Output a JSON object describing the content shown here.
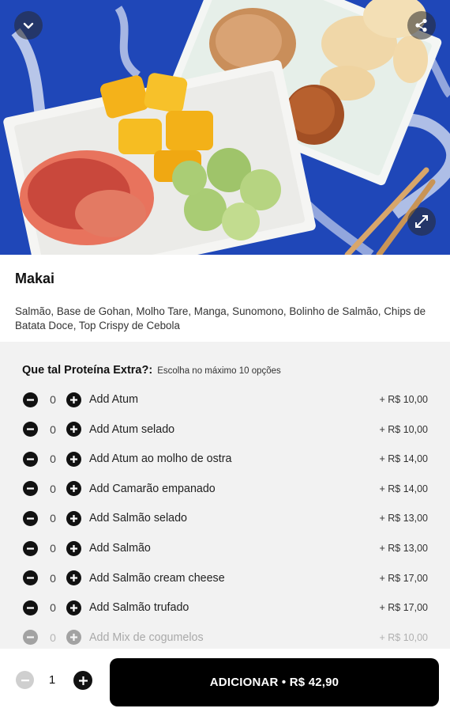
{
  "hero": {
    "collapse_icon": "chevron-down-icon",
    "share_icon": "share-icon",
    "expand_icon": "expand-icon"
  },
  "product": {
    "title": "Makai",
    "description": "Salmão, Base de Gohan, Molho Tare, Manga, Sunomono, Bolinho de Salmão, Chips de Batata Doce, Top Crispy de Cebola"
  },
  "options": {
    "title": "Que tal Proteína Extra?:",
    "subtitle": "Escolha no máximo 10 opções",
    "items": [
      {
        "label": "Add Atum",
        "qty": "0",
        "price": "+ R$ 10,00"
      },
      {
        "label": "Add Atum selado",
        "qty": "0",
        "price": "+ R$ 10,00"
      },
      {
        "label": "Add Atum ao molho de ostra",
        "qty": "0",
        "price": "+ R$ 14,00"
      },
      {
        "label": "Add Camarão empanado",
        "qty": "0",
        "price": "+ R$ 14,00"
      },
      {
        "label": "Add Salmão selado",
        "qty": "0",
        "price": "+ R$ 13,00"
      },
      {
        "label": "Add Salmão",
        "qty": "0",
        "price": "+ R$ 13,00"
      },
      {
        "label": "Add Salmão cream cheese",
        "qty": "0",
        "price": "+ R$ 17,00"
      },
      {
        "label": "Add Salmão trufado",
        "qty": "0",
        "price": "+ R$ 17,00"
      },
      {
        "label": "Add Mix de cogumelos",
        "qty": "0",
        "price": "+ R$ 10,00"
      }
    ]
  },
  "footer": {
    "quantity": "1",
    "add_label": "ADICIONAR • R$ 42,90"
  },
  "colors": {
    "hero_background": "#1f47b8",
    "options_background": "#f2f2f2",
    "primary_button": "#000000"
  }
}
